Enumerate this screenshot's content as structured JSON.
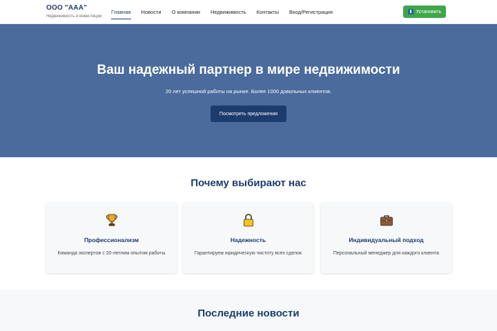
{
  "header": {
    "logo_title": "ООО \"ААА\"",
    "logo_subtitle": "Недвижимость и инвестиции",
    "nav": [
      {
        "label": "Главная",
        "active": true
      },
      {
        "label": "Новости",
        "active": false
      },
      {
        "label": "О компании",
        "active": false
      },
      {
        "label": "Недвижимость",
        "active": false
      },
      {
        "label": "Контакты",
        "active": false
      },
      {
        "label": "Вход/Регистрация",
        "active": false
      }
    ],
    "install_label": "Установить",
    "install_icon": "download-icon"
  },
  "hero": {
    "title": "Ваш надежный партнер в мире недвижимости",
    "subtitle": "20 лет успешной работы на рынке. Более 1000 довольных клиентов.",
    "button_label": "Посмотреть предложения"
  },
  "why": {
    "title": "Почему выбирают нас",
    "cards": [
      {
        "icon": "trophy-icon",
        "title": "Профессионализм",
        "text": "Команда экспертов с 20-летним опытом работы"
      },
      {
        "icon": "lock-icon",
        "title": "Надежность",
        "text": "Гарантируем юридическую чистоту всех сделок"
      },
      {
        "icon": "briefcase-icon",
        "title": "Индивидуальный подход",
        "text": "Персональный менеджер для каждого клиента"
      }
    ]
  },
  "news": {
    "title": "Последние новости"
  },
  "colors": {
    "primary": "#1d3c6e",
    "hero_bg": "#4a6b9c",
    "install_green": "#3fa74a",
    "card_bg": "#f7f8fa"
  }
}
